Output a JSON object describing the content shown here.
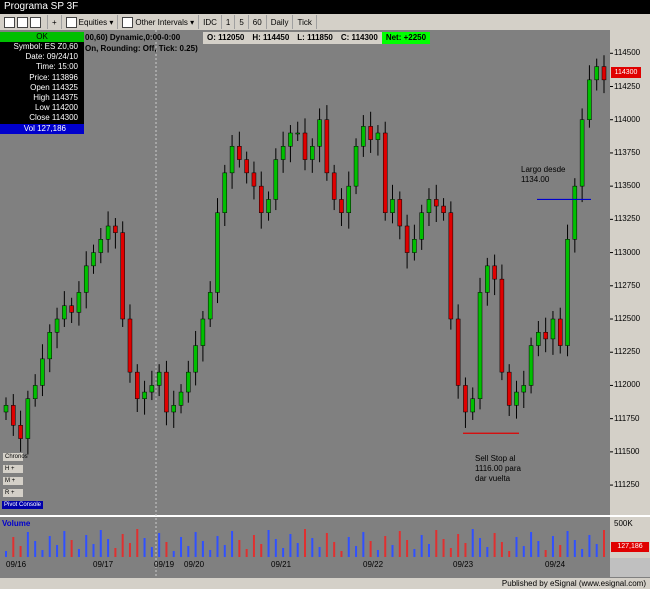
{
  "window": {
    "title": "Programa SP 3F"
  },
  "toolbar": {
    "equities": "Equities",
    "other_intervals": "Other Intervals",
    "idc": "IDC",
    "i1": "1",
    "i5": "5",
    "i60": "60",
    "daily": "Daily",
    "tick": "Tick"
  },
  "info": {
    "ok": "OK",
    "rows": [
      "Symbol: ES Z0,60",
      "Date: 09/24/10",
      "Time: 15:00",
      "Price: 113896",
      "Open 114325",
      "High 114375",
      "Low 114200",
      "Close 114300"
    ],
    "vol": "Vol 127,186"
  },
  "study": {
    "line1": "00,60) Dynamic,0:00-0:00",
    "line2": "On, Rounding: Off, Tick: 0.25)"
  },
  "ohlc": {
    "o": "O: 112050",
    "h": "H: 114450",
    "l": "L: 111850",
    "c": "C: 114300",
    "net": "Net: +2250"
  },
  "annotations": {
    "largo": "Largo desde\n1134.00",
    "sell": "Sell Stop al\n1116.00 para\ndar vuelta"
  },
  "price_tag": "114300",
  "volume": {
    "label": "Volume",
    "scale": "500K",
    "tag": "127,186"
  },
  "side_buttons": [
    "Chronos",
    "H +",
    "M +",
    "R +",
    "V +"
  ],
  "pivot": "Pivot Console",
  "status": "Published by eSignal (www.esignal.com)",
  "colors": {
    "up": "#00c000",
    "down": "#e00000",
    "bg": "#808080"
  },
  "chart_data": {
    "type": "candlestick",
    "x_ticks": [
      "09/16",
      "09/17",
      "09/19",
      "09/20",
      "09/21",
      "09/22",
      "09/23",
      "09/24"
    ],
    "y_ticks": [
      114500,
      114250,
      114000,
      113750,
      113500,
      113250,
      113000,
      112750,
      112500,
      112250,
      112000,
      111750,
      111500,
      111250
    ],
    "ylim": [
      111100,
      114600
    ],
    "levels": [
      {
        "price": 113400,
        "color": "#0000cc"
      },
      {
        "price": 111640,
        "color": "#e00000"
      }
    ],
    "series": [
      111850,
      111700,
      111600,
      111900,
      112000,
      112200,
      112400,
      112500,
      112600,
      112550,
      112700,
      112900,
      113000,
      113100,
      113200,
      113150,
      112500,
      112100,
      111900,
      111950,
      112000,
      112100,
      111800,
      111850,
      111950,
      112100,
      112300,
      112500,
      112700,
      113300,
      113600,
      113800,
      113700,
      113600,
      113500,
      113300,
      113400,
      113700,
      113800,
      113900,
      113900,
      113700,
      113800,
      114000,
      113600,
      113400,
      113300,
      113500,
      113800,
      113950,
      113850,
      113900,
      113300,
      113400,
      113200,
      113000,
      113100,
      113300,
      113400,
      113350,
      113300,
      112500,
      112000,
      111800,
      111900,
      112700,
      112900,
      112800,
      112100,
      111850,
      111950,
      112000,
      112300,
      112400,
      112350,
      112500,
      112300,
      113100,
      113500,
      114000,
      114300,
      114400,
      114300
    ]
  }
}
